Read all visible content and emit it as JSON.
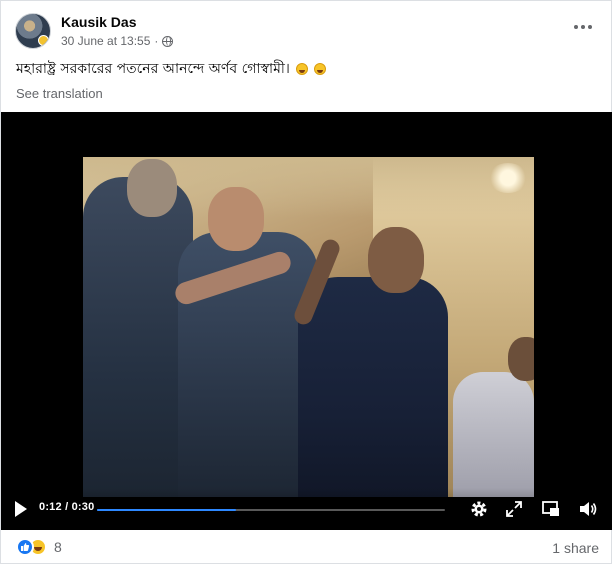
{
  "post": {
    "author": "Kausik Das",
    "timestamp": "30 June at 13:55",
    "meta_separator": "·",
    "audience_icon": "globe-icon",
    "more_icon": "more-options-icon",
    "caption": "মহারাষ্ট্র সরকারের পতনের আনন্দে অর্ণব গোস্বামী।",
    "caption_emojis": [
      "rolling-on-floor-laughing-emoji",
      "laughing-emoji"
    ],
    "see_translation": "See translation"
  },
  "video": {
    "current_time": "0:12",
    "duration": "0:30",
    "time_display": "0:12 / 0:30",
    "progress_fraction": 0.4,
    "controls": [
      "play-icon",
      "settings-icon",
      "fullscreen-icon",
      "picture-in-picture-icon",
      "volume-icon"
    ],
    "accent_color": "#2d88ff"
  },
  "footer": {
    "reaction_icons": [
      "like-reaction-icon",
      "haha-reaction-icon"
    ],
    "reaction_count": "8",
    "shares": "1 share"
  }
}
